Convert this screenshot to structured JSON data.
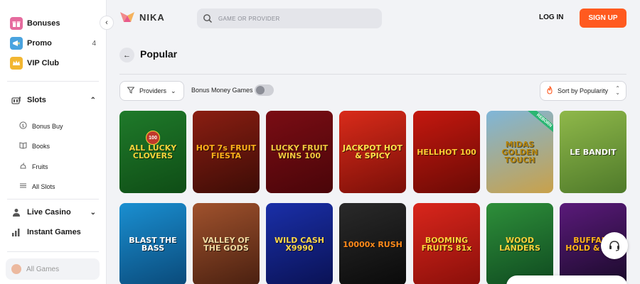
{
  "sidebar": {
    "top_items": [
      {
        "label": "Bonuses",
        "icon": "gift-icon",
        "color": "#e56b9e"
      },
      {
        "label": "Promo",
        "icon": "promo-icon",
        "count": "4",
        "color": "#4aa3df"
      },
      {
        "label": "VIP Club",
        "icon": "crown-icon",
        "color": "#f2b632"
      }
    ],
    "slots": {
      "label": "Slots",
      "icon": "slots-icon"
    },
    "slot_items": [
      {
        "label": "Bonus Buy",
        "icon": "dollar-icon"
      },
      {
        "label": "Books",
        "icon": "book-icon"
      },
      {
        "label": "Fruits",
        "icon": "fruit-icon"
      },
      {
        "label": "All Slots",
        "icon": "list-icon"
      }
    ],
    "live_casino": {
      "label": "Live Casino",
      "icon": "live-casino-icon"
    },
    "instant_games": {
      "label": "Instant Games",
      "icon": "chart-icon"
    },
    "all_games": {
      "label": "All Games",
      "icon": "all-games-icon"
    }
  },
  "header": {
    "brand": "NIKA",
    "search_placeholder": "GAME OR PROVIDER",
    "login_label": "LOG IN",
    "signup_label": "SIGN UP",
    "accent_color": "#ff5a1f"
  },
  "page": {
    "title": "Popular",
    "filters": {
      "providers_label": "Providers",
      "bonus_money_label": "Bonus Money Games",
      "bonus_money_enabled": false,
      "sort_label": "Sort by Popularity"
    }
  },
  "games": [
    {
      "title": "ALL LUCKY CLOVERS",
      "badge": "100",
      "bg": "#1f7a2a",
      "bg2": "#0f4d16",
      "fg": "#f5d33a"
    },
    {
      "title": "HOT 7s FRUIT FIESTA",
      "bg": "#8a1e12",
      "bg2": "#3d0c06",
      "fg": "#ffb21a"
    },
    {
      "title": "LUCKY FRUIT WINS 100",
      "bg": "#7a0d14",
      "bg2": "#4a0509",
      "fg": "#f3c93e"
    },
    {
      "title": "JACKPOT HOT & SPICY",
      "bg": "#d92b1a",
      "bg2": "#7a0f08",
      "fg": "#ffe14a"
    },
    {
      "title": "HELLHOT 100",
      "bg": "#c4180f",
      "bg2": "#6b0a05",
      "fg": "#ffcc33"
    },
    {
      "title": "MIDAS GOLDEN TOUCH",
      "ribbon": "REBORN",
      "bg": "#7fb6d9",
      "bg2": "#c9a14a",
      "fg": "#b8860b"
    },
    {
      "title": "LE BANDIT",
      "bg": "#8fb84a",
      "bg2": "#4f7a2a",
      "fg": "#ffffff"
    },
    {
      "title": "BLAST THE BASS",
      "bg": "#1a8fd1",
      "bg2": "#0a4a7a",
      "fg": "#ffffff"
    },
    {
      "title": "VALLEY OF THE GODS",
      "bg": "#a0522d",
      "bg2": "#4a2010",
      "fg": "#f0d9a0"
    },
    {
      "title": "WILD CASH X9990",
      "bg": "#1a2fa8",
      "bg2": "#0a1255",
      "fg": "#ffd84a"
    },
    {
      "title": "10000x RUSH",
      "bg": "#2a2a2a",
      "bg2": "#0a0a0a",
      "fg": "#ff8a1a"
    },
    {
      "title": "BOOMING FRUITS 81x",
      "bg": "#d9261c",
      "bg2": "#8a0f0a",
      "fg": "#ffd23a"
    },
    {
      "title": "WOOD LANDERS",
      "bg": "#2e8f3a",
      "bg2": "#0f4a20",
      "fg": "#f7d33a"
    },
    {
      "title": "BUFFALO HOLD & WIN",
      "bg": "#5a1a7a",
      "bg2": "#1a0a2a",
      "fg": "#ffb21a"
    }
  ]
}
